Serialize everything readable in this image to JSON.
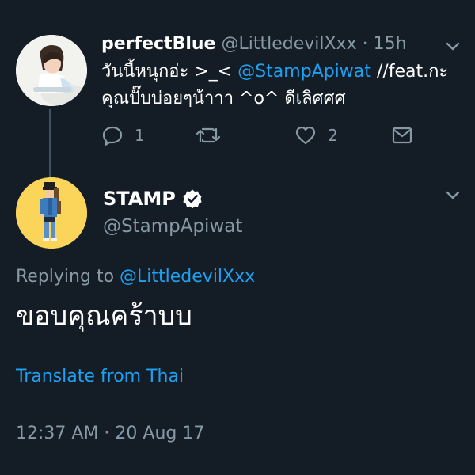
{
  "tweet1": {
    "display_name": "perfectBlue",
    "handle": "@LittledevilXxx",
    "separator": " · ",
    "time": "15h",
    "text_part1": "วันนี้หนุกอ่ะ >_< ",
    "mention": "@StampApiwat",
    "text_part2": " //feat.กะ",
    "text_line2": "คุณปั๊บบ่อยๆน้าาา ^o^ ดีเลิศศศ",
    "reply_count": "1",
    "retweet_count": "",
    "like_count": "2"
  },
  "tweet2": {
    "display_name": "STAMP",
    "handle": "@StampApiwat",
    "replying_prefix": "Replying to ",
    "replying_to": "@LittledevilXxx",
    "text": "ขอบคุณคร้าบบ",
    "translate_label": "Translate from Thai",
    "timestamp": "12:37 AM · 20 Aug 17"
  },
  "icons": {
    "reply": "reply-icon",
    "retweet": "retweet-icon",
    "like": "heart-icon",
    "dm": "envelope-icon",
    "menu": "chevron-down-icon",
    "verified": "verified-badge-icon"
  },
  "colors": {
    "background": "#141d26",
    "text_primary": "#ffffff",
    "text_secondary": "#8899a6",
    "link": "#1da1f2",
    "avatar2_bg": "#fbd55a"
  }
}
